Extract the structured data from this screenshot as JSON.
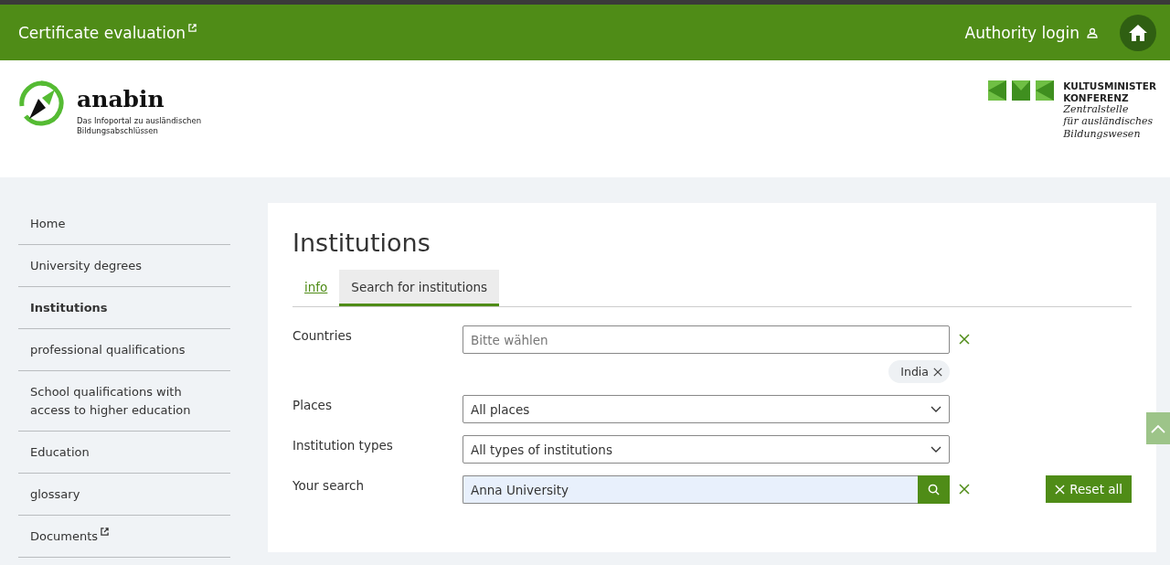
{
  "topbar": {
    "link": "Certificate evaluation",
    "login": "Authority login"
  },
  "logo": {
    "name": "anabin",
    "tagline": "Das Infoportal zu ausländischen Bildungsabschlüssen"
  },
  "partner": {
    "line1": "KULTUSMINISTER",
    "line2": "KONFERENZ",
    "line3": "Zentralstelle",
    "line4": "für ausländisches",
    "line5": "Bildungswesen"
  },
  "sidebar": {
    "items": [
      {
        "label": "Home",
        "selected": false,
        "external": false
      },
      {
        "label": "University degrees",
        "selected": false,
        "external": false
      },
      {
        "label": "Institutions",
        "selected": true,
        "external": false
      },
      {
        "label": "professional qualifications",
        "selected": false,
        "external": false
      },
      {
        "label": "School qualifications with access to higher education",
        "selected": false,
        "external": false
      },
      {
        "label": "Education",
        "selected": false,
        "external": false
      },
      {
        "label": "glossary",
        "selected": false,
        "external": false
      },
      {
        "label": "Documents",
        "selected": false,
        "external": true
      }
    ]
  },
  "page": {
    "title": "Institutions",
    "tabs": [
      {
        "label": "info",
        "selected": false
      },
      {
        "label": "Search for institutions",
        "selected": true
      }
    ],
    "form": [
      {
        "kind": "multiselect",
        "label": "Countries",
        "placeholder": "Bitte wählen",
        "chips": [
          "India"
        ]
      },
      {
        "kind": "select",
        "label": "Places",
        "value": "All places"
      },
      {
        "kind": "select",
        "label": "Institution types",
        "value": "All types of institutions"
      },
      {
        "kind": "search",
        "label": "Your search",
        "value": "Anna University"
      }
    ],
    "reset": "Reset all"
  }
}
